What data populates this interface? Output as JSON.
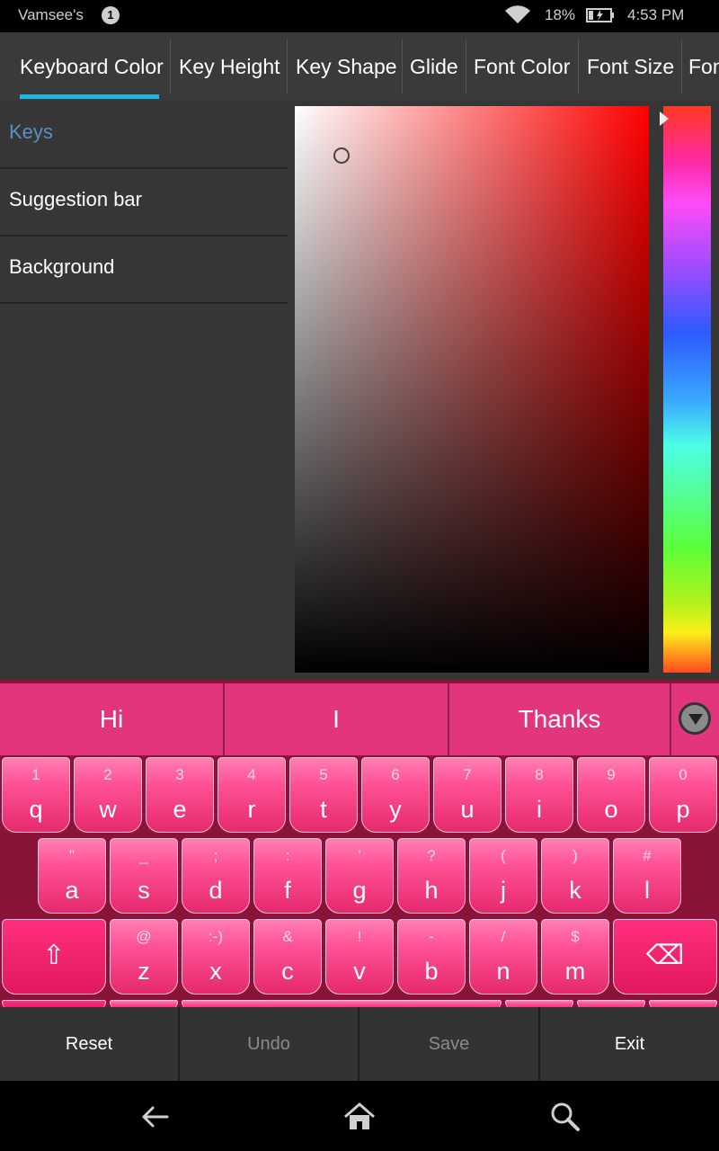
{
  "status_bar": {
    "device_name": "Vamsee's",
    "notification_count": "1",
    "battery_percent": "18%",
    "time": "4:53 PM",
    "icons": [
      "wifi-icon",
      "battery-charging-icon"
    ]
  },
  "tabs": [
    {
      "label": "Keyboard Color",
      "selected": true
    },
    {
      "label": "Key Height"
    },
    {
      "label": "Key Shape"
    },
    {
      "label": "Glide"
    },
    {
      "label": "Font Color"
    },
    {
      "label": "Font Size"
    },
    {
      "label": "Fon"
    }
  ],
  "targets": [
    {
      "label": "Keys",
      "selected": true
    },
    {
      "label": "Suggestion bar"
    },
    {
      "label": "Background"
    }
  ],
  "picker": {
    "hue": "#ff0000",
    "hue_position": 0.02,
    "saturation": 0.13,
    "value": 0.91
  },
  "suggestions": [
    "Hi",
    "I",
    "Thanks"
  ],
  "keyboard": {
    "row1": [
      {
        "alt": "1",
        "key": "q"
      },
      {
        "alt": "2",
        "key": "w"
      },
      {
        "alt": "3",
        "key": "e"
      },
      {
        "alt": "4",
        "key": "r"
      },
      {
        "alt": "5",
        "key": "t"
      },
      {
        "alt": "6",
        "key": "y"
      },
      {
        "alt": "7",
        "key": "u"
      },
      {
        "alt": "8",
        "key": "i"
      },
      {
        "alt": "9",
        "key": "o"
      },
      {
        "alt": "0",
        "key": "p"
      }
    ],
    "row2": [
      {
        "alt": "\"",
        "key": "a"
      },
      {
        "alt": "_",
        "key": "s"
      },
      {
        "alt": ";",
        "key": "d"
      },
      {
        "alt": ":",
        "key": "f"
      },
      {
        "alt": "'",
        "key": "g"
      },
      {
        "alt": "?",
        "key": "h"
      },
      {
        "alt": "(",
        "key": "j"
      },
      {
        "alt": ")",
        "key": "k"
      },
      {
        "alt": "#",
        "key": "l"
      }
    ],
    "row3": [
      {
        "alt": "@",
        "key": "z"
      },
      {
        "alt": ":-)",
        "key": "x"
      },
      {
        "alt": "&",
        "key": "c"
      },
      {
        "alt": "!",
        "key": "v"
      },
      {
        "alt": "-",
        "key": "b"
      },
      {
        "alt": "/",
        "key": "n"
      },
      {
        "alt": "$",
        "key": "m"
      }
    ],
    "shift_symbol": "⇧",
    "backspace_symbol": "⌫"
  },
  "actions": [
    {
      "label": "Reset",
      "enabled": true
    },
    {
      "label": "Undo",
      "enabled": false
    },
    {
      "label": "Save",
      "enabled": false
    },
    {
      "label": "Exit",
      "enabled": true
    }
  ],
  "nav": [
    "back-icon",
    "home-icon",
    "search-icon"
  ],
  "colors": {
    "tab_indicator": "#1fb3e0",
    "selected_target": "#5b8fc7",
    "suggestion_bar": "#e2357d",
    "key_top": "#ff7fb3",
    "key_bottom": "#e6296d",
    "keyboard_background": "#8a1437"
  }
}
